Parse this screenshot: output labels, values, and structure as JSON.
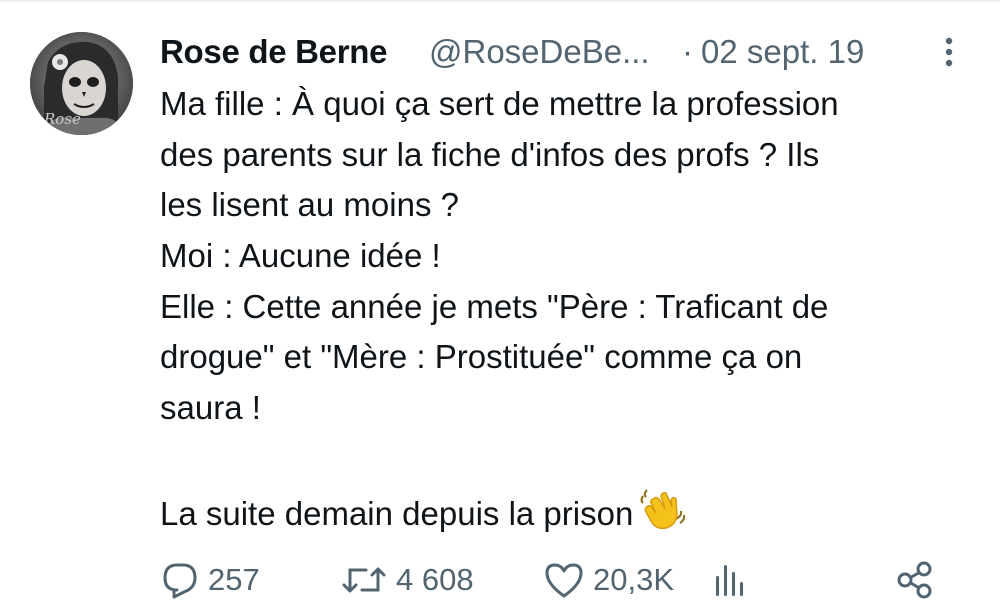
{
  "tweet": {
    "author_name": "Rose de Berne",
    "author_handle": "@RoseDeBe...",
    "separator": "·",
    "date": "02 sept. 19",
    "avatar_text": "Rose",
    "lines": [
      "Ma fille : À quoi ça sert de mettre la profession",
      "des parents sur la fiche d'infos des profs ? Ils",
      "les lisent au moins ?",
      "Moi : Aucune idée !",
      "Elle : Cette année je mets \"Père : Traficant de",
      "drogue\" et \"Mère : Prostituée\" comme ça on",
      "saura !"
    ],
    "last_line": "La suite demain depuis la prison",
    "emoji": "waving-hand-emoji"
  },
  "actions": {
    "replies": "257",
    "retweets": "4 608",
    "likes": "20,3K"
  },
  "icons": {
    "more": "more-vertical-icon",
    "reply": "reply-icon",
    "retweet": "retweet-icon",
    "like": "heart-icon",
    "views": "views-icon",
    "share": "share-icon"
  },
  "colors": {
    "text_primary": "#0f1419",
    "text_secondary": "#536471",
    "background": "#ffffff",
    "emoji_yellow": "#f5c21b"
  }
}
